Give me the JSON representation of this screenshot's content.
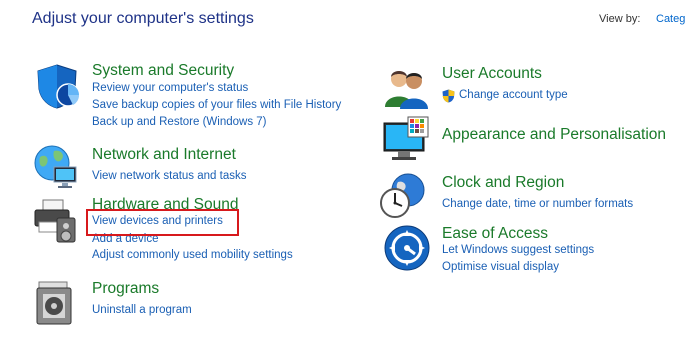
{
  "header": {
    "title": "Adjust your computer's settings",
    "view_by_label": "View by:",
    "view_by_value": "Categ"
  },
  "categories": {
    "system_security": {
      "title": "System and Security",
      "icon": "shield-icon",
      "links": [
        "Review your computer's status",
        "Save backup copies of your files with File History",
        "Back up and Restore (Windows 7)"
      ]
    },
    "network": {
      "title": "Network and Internet",
      "icon": "network-globe-icon",
      "links": [
        "View network status and tasks"
      ]
    },
    "hardware": {
      "title": "Hardware and Sound",
      "icon": "printer-speaker-icon",
      "links": [
        "View devices and printers",
        "Add a device",
        "Adjust commonly used mobility settings"
      ]
    },
    "programs": {
      "title": "Programs",
      "icon": "programs-disc-icon",
      "links": [
        "Uninstall a program"
      ]
    },
    "user_accounts": {
      "title": "User Accounts",
      "icon": "users-icon",
      "links": [
        "Change account type"
      ]
    },
    "appearance": {
      "title": "Appearance and Personalisation",
      "icon": "monitor-palette-icon",
      "links": []
    },
    "clock": {
      "title": "Clock and Region",
      "icon": "clock-globe-icon",
      "links": [
        "Change date, time or number formats"
      ]
    },
    "ease": {
      "title": "Ease of Access",
      "icon": "ease-of-access-icon",
      "links": [
        "Let Windows suggest settings",
        "Optimise visual display"
      ]
    }
  },
  "highlight_color": "#d7191c"
}
